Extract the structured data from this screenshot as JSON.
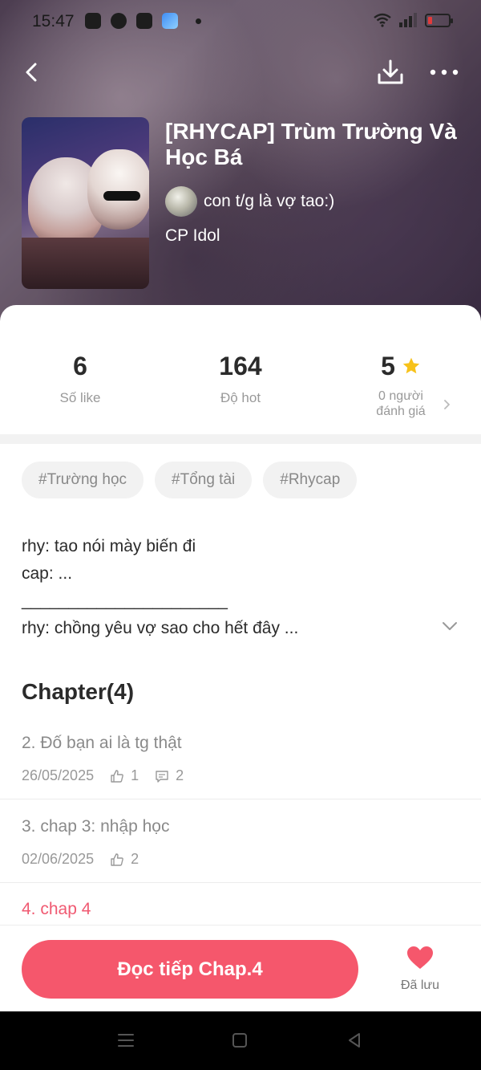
{
  "status_bar": {
    "time": "15:47"
  },
  "story": {
    "title": "[RHYCAP] Trùm Trường Và Học Bá",
    "author": "con t/g là vợ tao:)",
    "category": "CP Idol"
  },
  "stats": {
    "likes": {
      "value": "6",
      "label": "Số like"
    },
    "hot": {
      "value": "164",
      "label": "Độ hot"
    },
    "rating": {
      "value": "5",
      "label_line1": "0 người",
      "label_line2": "đánh giá"
    }
  },
  "tags": [
    "#Trường học",
    "#Tổng tài",
    "#Rhycap"
  ],
  "description": {
    "lines": [
      "rhy: tao nói mày biến đi",
      "cap: ...",
      "______________________",
      "rhy: chồng yêu vợ sao cho hết đây ..."
    ]
  },
  "chapters": {
    "heading": "Chapter(4)",
    "items": [
      {
        "title": "2. Đố bạn ai là tg thật",
        "date": "26/05/2025",
        "likes": "1",
        "comments": "2"
      },
      {
        "title": "3. chap 3: nhập học",
        "date": "02/06/2025",
        "likes": "2"
      },
      {
        "title": "4. chap 4"
      }
    ]
  },
  "actions": {
    "continue_label": "Đọc tiếp Chap.4",
    "saved_label": "Đã lưu"
  },
  "colors": {
    "accent": "#f5576c",
    "active_chapter": "#f05a72",
    "star": "#f7c21a"
  },
  "icons": [
    "back-icon",
    "download-icon",
    "more-icon",
    "star-icon",
    "chevron-right-icon",
    "chevron-down-icon",
    "like-icon",
    "comment-icon",
    "heart-icon"
  ]
}
